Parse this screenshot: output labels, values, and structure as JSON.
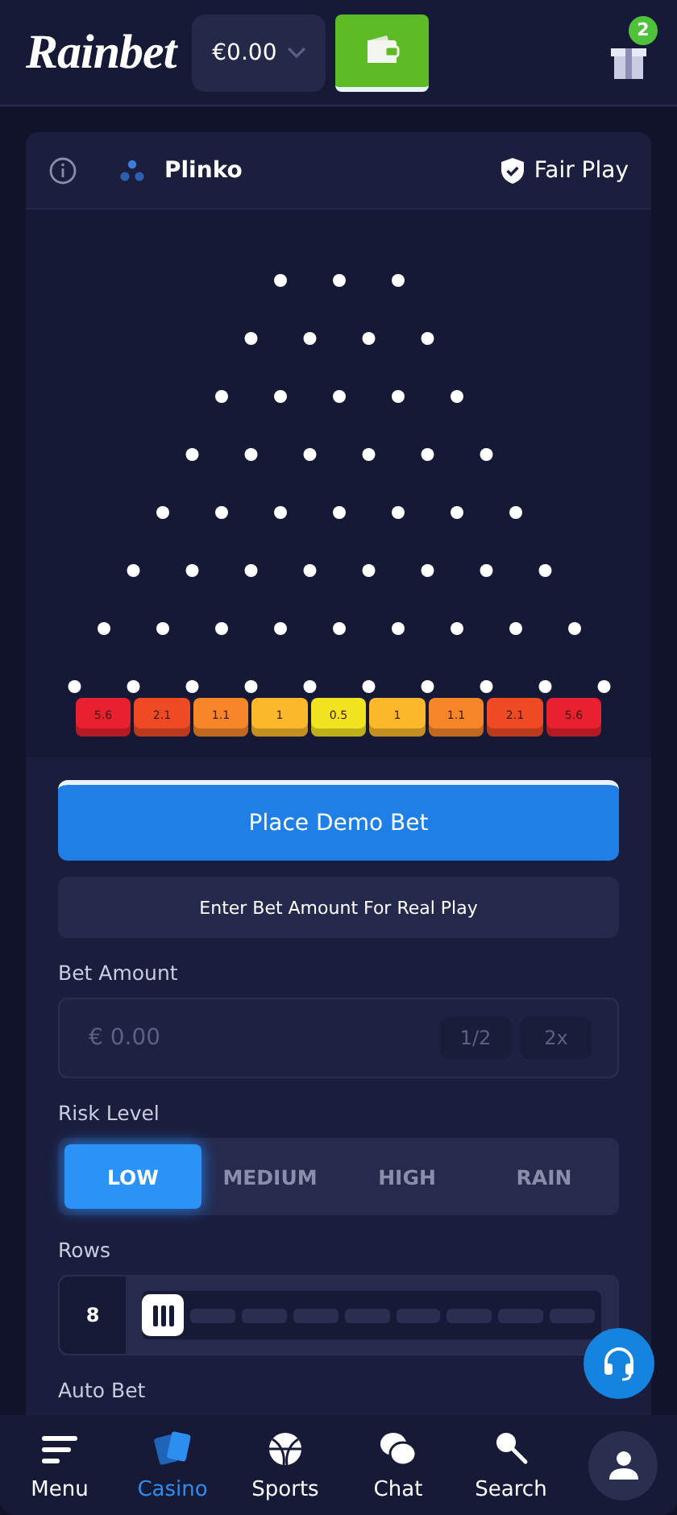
{
  "header": {
    "logo": "Rainbet",
    "balance": "€0.00",
    "gift_badge": "2"
  },
  "game": {
    "title": "Plinko",
    "fair_play": "Fair Play",
    "multipliers": [
      {
        "label": "5.6",
        "color": "#e8202f"
      },
      {
        "label": "2.1",
        "color": "#f04a24"
      },
      {
        "label": "1.1",
        "color": "#f7862a"
      },
      {
        "label": "1",
        "color": "#fbb82b"
      },
      {
        "label": "0.5",
        "color": "#f2e321"
      },
      {
        "label": "1",
        "color": "#fbb82b"
      },
      {
        "label": "1.1",
        "color": "#f7862a"
      },
      {
        "label": "2.1",
        "color": "#f04a24"
      },
      {
        "label": "5.6",
        "color": "#e8202f"
      }
    ]
  },
  "controls": {
    "demo_button": "Place Demo Bet",
    "real_play_note": "Enter Bet Amount For Real Play",
    "bet_amount": {
      "label": "Bet Amount",
      "placeholder": "€ 0.00",
      "buttons": [
        "1/2",
        "2x"
      ]
    },
    "risk_level": {
      "label": "Risk Level",
      "options": [
        {
          "label": "LOW",
          "selected": true
        },
        {
          "label": "MEDIUM",
          "selected": false
        },
        {
          "label": "HIGH",
          "selected": false
        },
        {
          "label": "RAIN",
          "selected": false
        }
      ]
    },
    "rows": {
      "label": "Rows",
      "value": "8"
    },
    "auto_bet": {
      "label": "Auto Bet"
    }
  },
  "bottom_nav": [
    {
      "label": "Menu",
      "kind": "menu",
      "selected": false
    },
    {
      "label": "Casino",
      "kind": "casino",
      "selected": true
    },
    {
      "label": "Sports",
      "kind": "sports",
      "selected": false
    },
    {
      "label": "Chat",
      "kind": "chat",
      "selected": false
    },
    {
      "label": "Search",
      "kind": "search",
      "selected": false
    }
  ]
}
